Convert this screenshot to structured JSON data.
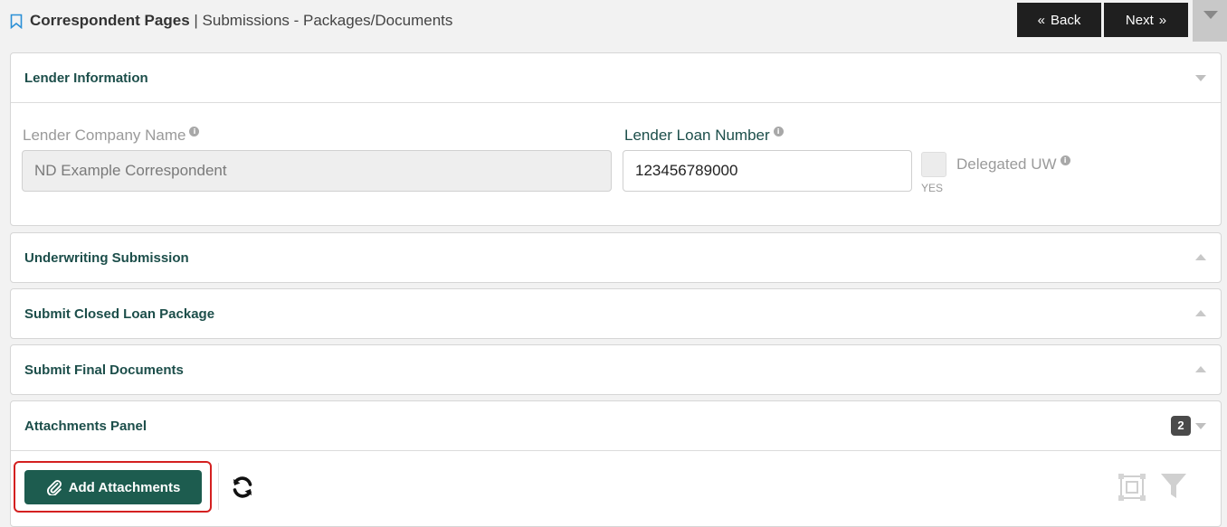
{
  "header": {
    "title_strong": "Correspondent Pages",
    "separator": " | ",
    "title_rest": "Submissions - Packages/Documents",
    "back_label": "Back",
    "next_label": "Next"
  },
  "lender_panel": {
    "title": "Lender Information",
    "company_label": "Lender Company Name",
    "company_value": "ND Example Correspondent",
    "loan_number_label": "Lender Loan Number",
    "loan_number_value": "123456789000",
    "delegated_label": "Delegated UW",
    "delegated_yes": "YES"
  },
  "panels": {
    "underwriting": "Underwriting Submission",
    "closed_loan": "Submit Closed Loan Package",
    "final_docs": "Submit Final Documents"
  },
  "attachments": {
    "title": "Attachments Panel",
    "count": "2",
    "add_label": "Add Attachments"
  },
  "colors": {
    "accent": "#1d5c4f",
    "heading": "#1c4e4a",
    "highlight": "#d42020"
  }
}
